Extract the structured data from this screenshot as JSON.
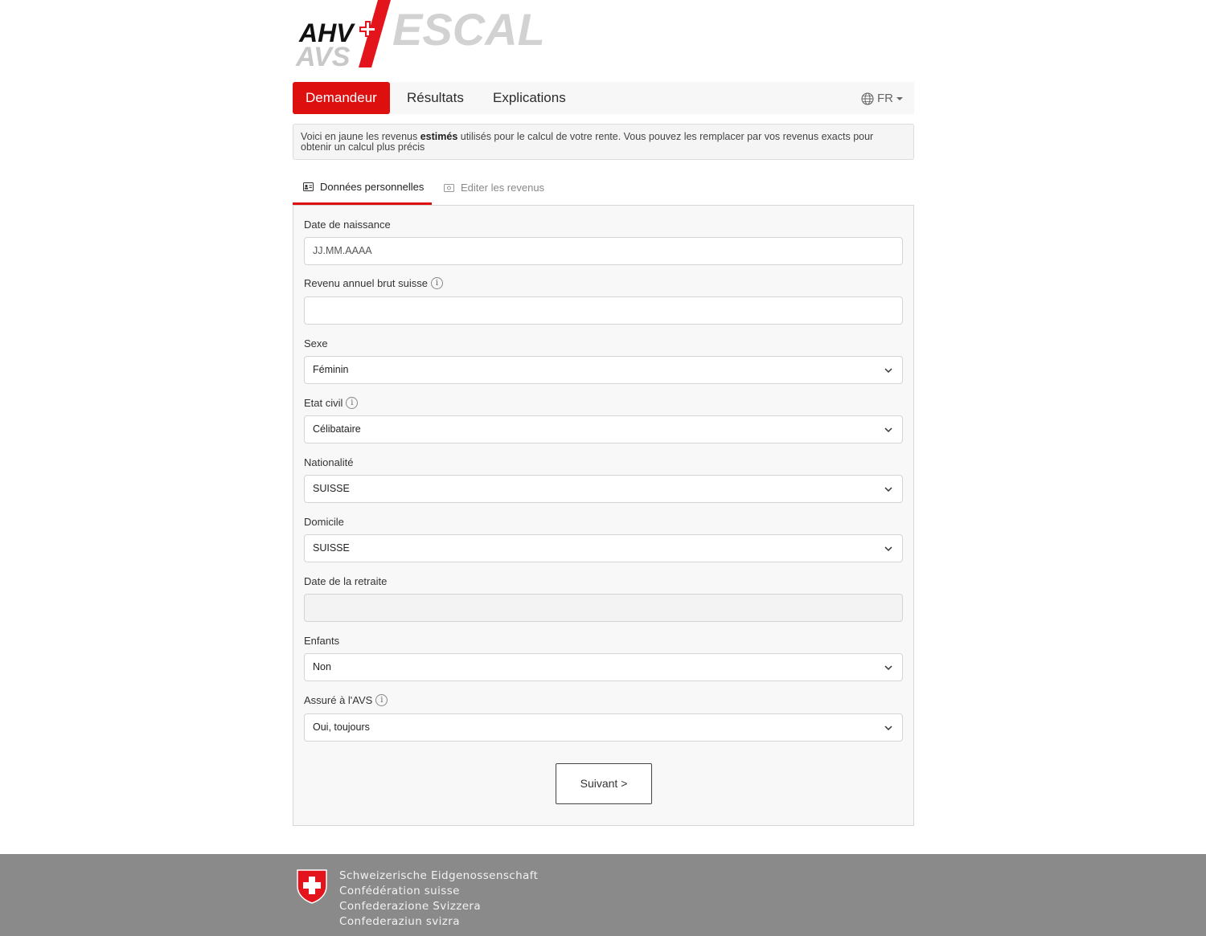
{
  "logo": {
    "line1": "AHV",
    "line2": "AVS",
    "brand": "ESCAL"
  },
  "nav": {
    "tabs": [
      {
        "label": "Demandeur",
        "active": true
      },
      {
        "label": "Résultats",
        "active": false
      },
      {
        "label": "Explications",
        "active": false
      }
    ],
    "language": "FR"
  },
  "notice": {
    "before": "Voici en jaune les revenus ",
    "bold": "estimés",
    "after": " utilisés pour le calcul de votre rente. Vous pouvez les remplacer par vos revenus exacts pour obtenir un calcul plus précis"
  },
  "subtabs": [
    {
      "label": "Données personnelles",
      "icon": "id-card-icon",
      "active": true
    },
    {
      "label": "Editer les revenus",
      "icon": "money-icon",
      "active": false
    }
  ],
  "form": {
    "birth_date": {
      "label": "Date de naissance",
      "placeholder": "JJ.MM.AAAA",
      "value": ""
    },
    "income": {
      "label": "Revenu annuel brut suisse",
      "value": ""
    },
    "sex": {
      "label": "Sexe",
      "value": "Féminin"
    },
    "civil_status": {
      "label": "Etat civil",
      "value": "Célibataire"
    },
    "nationality": {
      "label": "Nationalité",
      "value": "SUISSE"
    },
    "domicile": {
      "label": "Domicile",
      "value": "SUISSE"
    },
    "retirement_date": {
      "label": "Date de la retraite",
      "value": ""
    },
    "children": {
      "label": "Enfants",
      "value": "Non"
    },
    "insured": {
      "label": "Assuré à l'AVS",
      "value": "Oui, toujours"
    },
    "next_button": "Suivant >"
  },
  "footer": {
    "lines": [
      "Schweizerische Eidgenossenschaft",
      "Confédération suisse",
      "Confederazione Svizzera",
      "Confederaziun svizra"
    ]
  },
  "colors": {
    "accent": "#dd0f0f",
    "footer_bg": "#8a8a8a",
    "panel_bg": "#f8f8f8"
  }
}
